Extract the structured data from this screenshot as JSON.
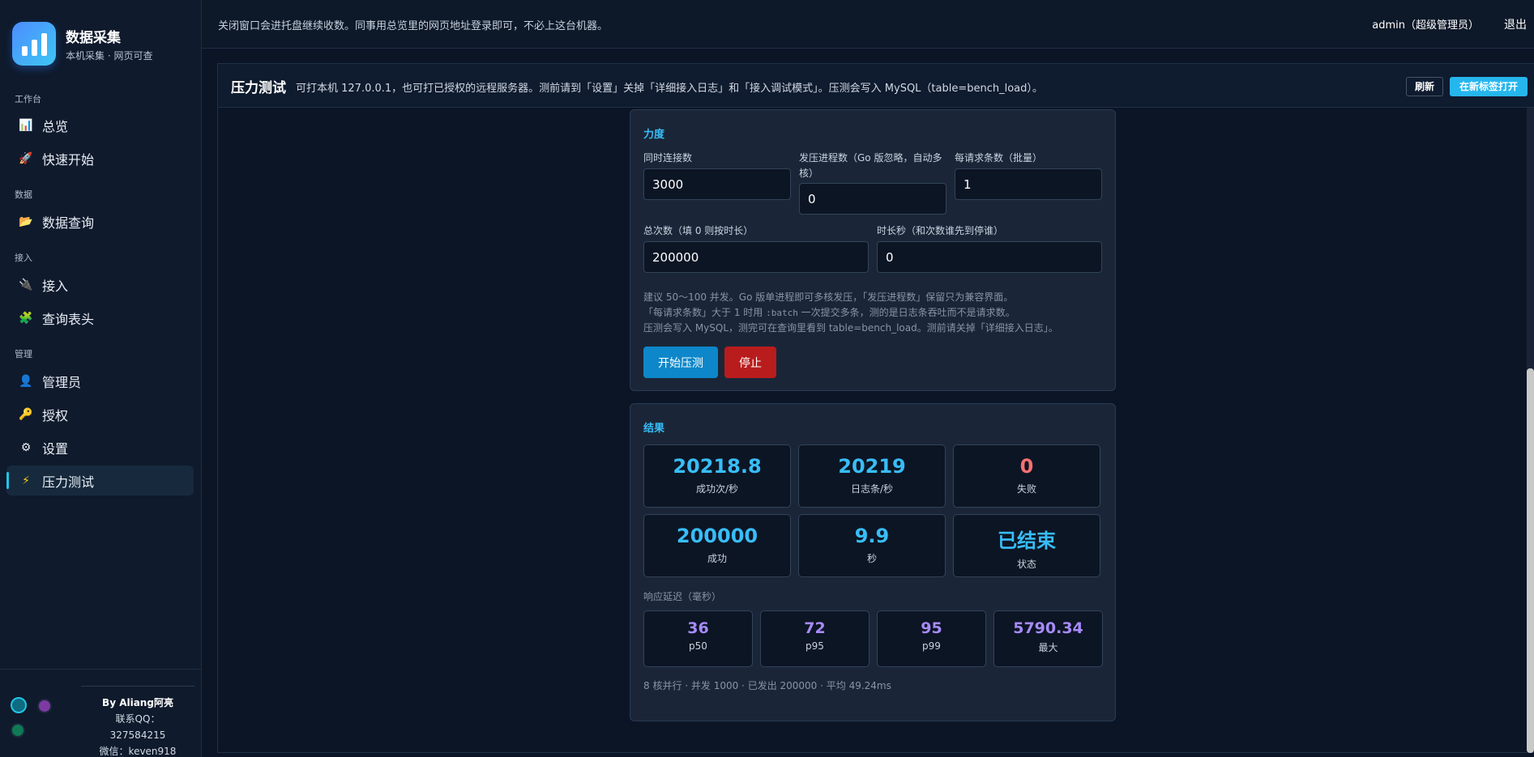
{
  "brand": {
    "title": "数据采集",
    "subtitle": "本机采集 · 网页可查"
  },
  "nav": {
    "groups": [
      "工作台",
      "数据",
      "接入",
      "管理"
    ],
    "items": [
      {
        "label": "总览",
        "icon": "bar-chart-icon"
      },
      {
        "label": "快速开始",
        "icon": "rocket-icon"
      },
      {
        "label": "数据查询",
        "icon": "folder-icon"
      },
      {
        "label": "接入",
        "icon": "plug-icon"
      },
      {
        "label": "查询表头",
        "icon": "puzzle-icon"
      },
      {
        "label": "管理员",
        "icon": "user-icon"
      },
      {
        "label": "授权",
        "icon": "key-icon"
      },
      {
        "label": "设置",
        "icon": "gear-icon"
      },
      {
        "label": "压力测试",
        "icon": "lightning-icon"
      }
    ],
    "active": "压力测试"
  },
  "footer": {
    "by": "By Aliang阿亮",
    "qq_label": "联系QQ：",
    "qq": "327584215",
    "wechat": "微信：keven918"
  },
  "topbar": {
    "notice": "关闭窗口会进托盘继续收数。同事用总览里的网页地址登录即可，不必上这台机器。",
    "user": "admin（超级管理员）",
    "logout": "退出"
  },
  "panel": {
    "title": "压力测试",
    "desc": "可打本机 127.0.0.1，也可打已授权的远程服务器。测前请到「设置」关掉「详细接入日志」和「接入调试模式」。压测会写入 MySQL（table=bench_load）。",
    "refresh": "刷新",
    "open_new_tab": "在新标签打开"
  },
  "force": {
    "title": "力度",
    "concurrency_label": "同时连接数",
    "concurrency": "3000",
    "procs_label": "发压进程数（Go 版忽略，自动多核）",
    "procs": "0",
    "batch_label": "每请求条数（批量）",
    "batch": "1",
    "total_label": "总次数（填 0 则按时长）",
    "total": "200000",
    "duration_label": "时长秒（和次数谁先到停谁）",
    "duration": "0",
    "hint1": "建议 50～100 并发。Go 版单进程即可多核发压，「发压进程数」保留只为兼容界面。",
    "hint2a": "「每请求条数」大于 1 时用 ",
    "hint2code": ":batch",
    "hint2b": " 一次提交多条，测的是日志条吞吐而不是请求数。",
    "hint3": "压测会写入 MySQL，测完可在查询里看到 table=bench_load。测前请关掉「详细接入日志」。",
    "start": "开始压测",
    "stop": "停止"
  },
  "results": {
    "title": "结果",
    "stats": [
      {
        "value": "20218.8",
        "label": "成功次/秒"
      },
      {
        "value": "20219",
        "label": "日志条/秒"
      },
      {
        "value": "0",
        "label": "失败"
      },
      {
        "value": "200000",
        "label": "成功"
      },
      {
        "value": "9.9",
        "label": "秒"
      },
      {
        "value": "已结束",
        "label": "状态"
      }
    ],
    "latency_label": "响应延迟（毫秒）",
    "latency": [
      {
        "value": "36",
        "label": "p50"
      },
      {
        "value": "72",
        "label": "p95"
      },
      {
        "value": "95",
        "label": "p99"
      },
      {
        "value": "5790.34",
        "label": "最大"
      }
    ],
    "summary": "8 核并行 · 并发 1000 · 已发出 200000 · 平均 49.24ms"
  },
  "colors": {
    "accent": "#38bdf8",
    "danger": "#f87171",
    "latency": "#a78bfa",
    "start": "#0d87c9",
    "stop": "#b91c1c"
  }
}
